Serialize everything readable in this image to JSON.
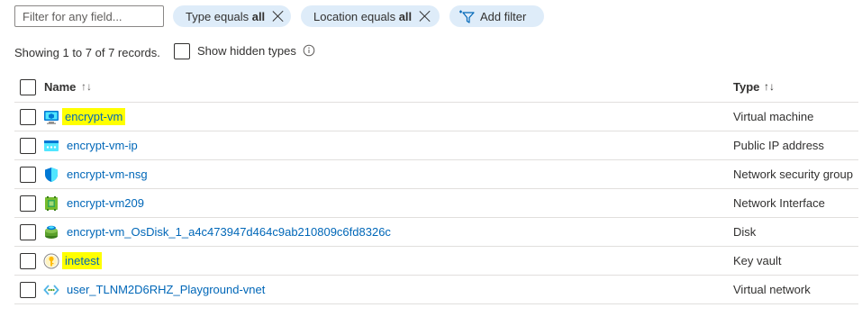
{
  "filter": {
    "placeholder": "Filter for any field..."
  },
  "pills": {
    "type": {
      "prefix": "Type equals ",
      "value": "all"
    },
    "location": {
      "prefix": "Location equals ",
      "value": "all"
    },
    "add_filter_label": "Add filter"
  },
  "summary": {
    "showing": "Showing 1 to 7 of 7 records.",
    "show_hidden_label": "Show hidden types"
  },
  "table": {
    "columns": {
      "name": "Name",
      "type": "Type",
      "name_sort": "↑↓",
      "type_sort": "↑↓"
    },
    "rows": [
      {
        "name": "encrypt-vm",
        "type": "Virtual machine",
        "icon": "virtual-machine-icon",
        "highlighted": true
      },
      {
        "name": "encrypt-vm-ip",
        "type": "Public IP address",
        "icon": "public-ip-icon",
        "highlighted": false
      },
      {
        "name": "encrypt-vm-nsg",
        "type": "Network security group",
        "icon": "nsg-shield-icon",
        "highlighted": false
      },
      {
        "name": "encrypt-vm209",
        "type": "Network Interface",
        "icon": "network-interface-icon",
        "highlighted": false
      },
      {
        "name": "encrypt-vm_OsDisk_1_a4c473947d464c9ab210809c6fd8326c",
        "type": "Disk",
        "icon": "disk-icon",
        "highlighted": false
      },
      {
        "name": "inetest",
        "type": "Key vault",
        "icon": "key-vault-icon",
        "highlighted": true
      },
      {
        "name": "user_TLNM2D6RHZ_Playground-vnet",
        "type": "Virtual network",
        "icon": "virtual-network-icon",
        "highlighted": false
      }
    ]
  },
  "colors": {
    "link": "#0067b8",
    "pill_bg": "#deecf9",
    "highlight": "#ffff00",
    "divider": "#e1dfdd"
  }
}
